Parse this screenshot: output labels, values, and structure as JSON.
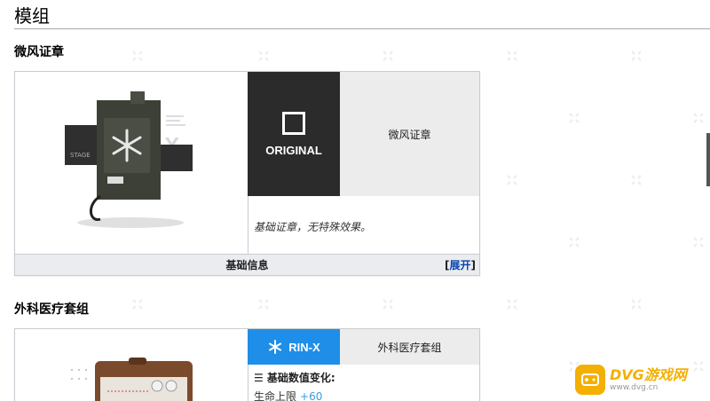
{
  "section": {
    "title": "模组"
  },
  "module1": {
    "heading": "微风证章",
    "type_label": "ORIGINAL",
    "name": "微风证章",
    "description": "基础证章，无特殊效果。",
    "info_bar_label": "基础信息",
    "toggle_open": "[",
    "toggle_label": "展开",
    "toggle_close": "]",
    "image_stage_text": "STAGE"
  },
  "module2": {
    "heading": "外科医疗套组",
    "type_label": "RIN-X",
    "name": "外科医疗套组",
    "stats_title": "☰ 基础数值变化:",
    "stat_label": "生命上限",
    "stat_value": "+60"
  },
  "watermark": {
    "title": "DVG游戏网",
    "sub": "www.dvg.cn"
  },
  "colors": {
    "accent_blue": "#1f8ee8",
    "dark_box": "#2b2b2b",
    "link": "#0645ad",
    "logo_yellow": "#f3b000"
  }
}
